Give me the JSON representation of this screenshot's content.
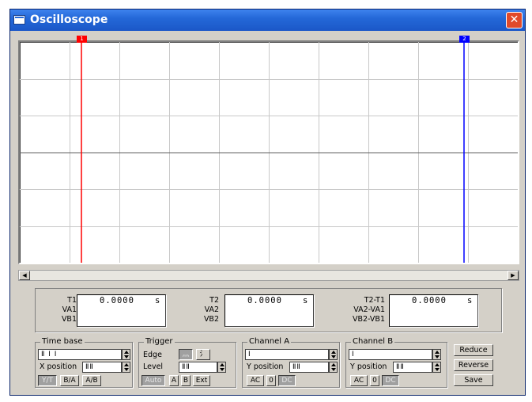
{
  "window": {
    "title": "Oscilloscope",
    "close_label": "✕"
  },
  "cursors": {
    "c1_label": "1",
    "c2_label": "2",
    "c1_color": "#ff0000",
    "c2_color": "#0000ff"
  },
  "scroll": {
    "left_arrow": "◀",
    "right_arrow": "▶"
  },
  "readout": {
    "t1": {
      "labels": [
        "T1",
        "VA1",
        "VB1"
      ],
      "value": "0.0000",
      "unit": "s"
    },
    "t2": {
      "labels": [
        "T2",
        "VA2",
        "VB2"
      ],
      "value": "0.0000",
      "unit": "s"
    },
    "diff": {
      "labels": [
        "T2-T1",
        "VA2-VA1",
        "VB2-VB1"
      ],
      "value": "0.0000",
      "unit": "s"
    }
  },
  "timebase": {
    "title": "Time base",
    "scale_value": "Ⅱ Ⅰ Ⅰ",
    "xpos_label": "X position",
    "xpos_value": "ⅡⅡ",
    "yt_label": "Y/T",
    "ba_label": "B/A",
    "ab_label": "A/B"
  },
  "trigger": {
    "title": "Trigger",
    "edge_label": "Edge",
    "edge_rise": "⺣",
    "edge_fall": "⺡",
    "level_label": "Level",
    "level_value": "ⅡⅡ",
    "auto_label": "Auto",
    "a_label": "A",
    "b_label": "B",
    "ext_label": "Ext"
  },
  "channel_a": {
    "title": "Channel A",
    "scale_value": "Ⅰ",
    "ypos_label": "Y position",
    "ypos_value": "ⅡⅡ",
    "ac_label": "AC",
    "zero_label": "0",
    "dc_label": "DC"
  },
  "channel_b": {
    "title": "Channel B",
    "scale_value": "Ⅰ",
    "ypos_label": "Y position",
    "ypos_value": "ⅡⅡ",
    "ac_label": "AC",
    "zero_label": "0",
    "dc_label": "DC"
  },
  "actions": {
    "reduce": "Reduce",
    "reverse": "Reverse",
    "save": "Save"
  }
}
